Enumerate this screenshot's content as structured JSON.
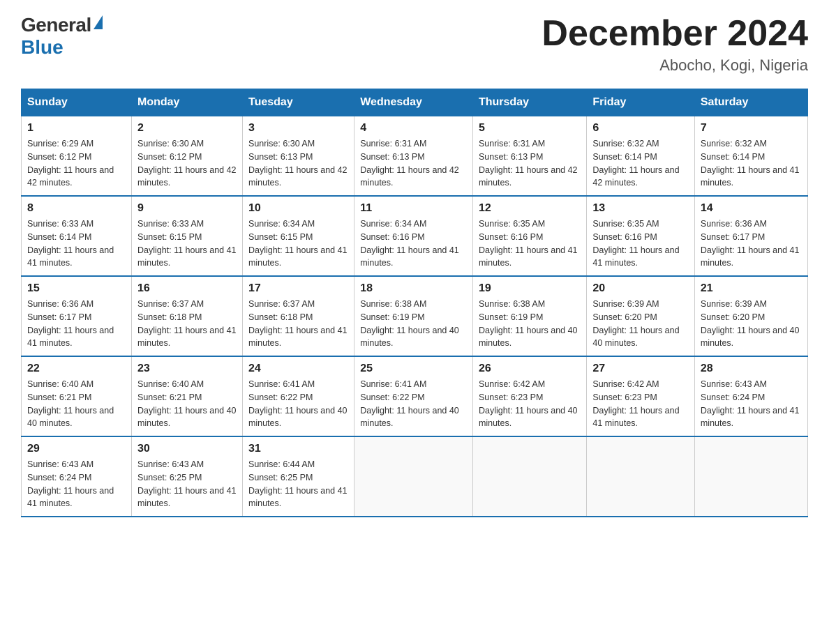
{
  "logo": {
    "general": "General",
    "blue": "Blue"
  },
  "title": "December 2024",
  "location": "Abocho, Kogi, Nigeria",
  "days_of_week": [
    "Sunday",
    "Monday",
    "Tuesday",
    "Wednesday",
    "Thursday",
    "Friday",
    "Saturday"
  ],
  "weeks": [
    [
      {
        "day": "1",
        "sunrise": "6:29 AM",
        "sunset": "6:12 PM",
        "daylight": "11 hours and 42 minutes."
      },
      {
        "day": "2",
        "sunrise": "6:30 AM",
        "sunset": "6:12 PM",
        "daylight": "11 hours and 42 minutes."
      },
      {
        "day": "3",
        "sunrise": "6:30 AM",
        "sunset": "6:13 PM",
        "daylight": "11 hours and 42 minutes."
      },
      {
        "day": "4",
        "sunrise": "6:31 AM",
        "sunset": "6:13 PM",
        "daylight": "11 hours and 42 minutes."
      },
      {
        "day": "5",
        "sunrise": "6:31 AM",
        "sunset": "6:13 PM",
        "daylight": "11 hours and 42 minutes."
      },
      {
        "day": "6",
        "sunrise": "6:32 AM",
        "sunset": "6:14 PM",
        "daylight": "11 hours and 42 minutes."
      },
      {
        "day": "7",
        "sunrise": "6:32 AM",
        "sunset": "6:14 PM",
        "daylight": "11 hours and 41 minutes."
      }
    ],
    [
      {
        "day": "8",
        "sunrise": "6:33 AM",
        "sunset": "6:14 PM",
        "daylight": "11 hours and 41 minutes."
      },
      {
        "day": "9",
        "sunrise": "6:33 AM",
        "sunset": "6:15 PM",
        "daylight": "11 hours and 41 minutes."
      },
      {
        "day": "10",
        "sunrise": "6:34 AM",
        "sunset": "6:15 PM",
        "daylight": "11 hours and 41 minutes."
      },
      {
        "day": "11",
        "sunrise": "6:34 AM",
        "sunset": "6:16 PM",
        "daylight": "11 hours and 41 minutes."
      },
      {
        "day": "12",
        "sunrise": "6:35 AM",
        "sunset": "6:16 PM",
        "daylight": "11 hours and 41 minutes."
      },
      {
        "day": "13",
        "sunrise": "6:35 AM",
        "sunset": "6:16 PM",
        "daylight": "11 hours and 41 minutes."
      },
      {
        "day": "14",
        "sunrise": "6:36 AM",
        "sunset": "6:17 PM",
        "daylight": "11 hours and 41 minutes."
      }
    ],
    [
      {
        "day": "15",
        "sunrise": "6:36 AM",
        "sunset": "6:17 PM",
        "daylight": "11 hours and 41 minutes."
      },
      {
        "day": "16",
        "sunrise": "6:37 AM",
        "sunset": "6:18 PM",
        "daylight": "11 hours and 41 minutes."
      },
      {
        "day": "17",
        "sunrise": "6:37 AM",
        "sunset": "6:18 PM",
        "daylight": "11 hours and 41 minutes."
      },
      {
        "day": "18",
        "sunrise": "6:38 AM",
        "sunset": "6:19 PM",
        "daylight": "11 hours and 40 minutes."
      },
      {
        "day": "19",
        "sunrise": "6:38 AM",
        "sunset": "6:19 PM",
        "daylight": "11 hours and 40 minutes."
      },
      {
        "day": "20",
        "sunrise": "6:39 AM",
        "sunset": "6:20 PM",
        "daylight": "11 hours and 40 minutes."
      },
      {
        "day": "21",
        "sunrise": "6:39 AM",
        "sunset": "6:20 PM",
        "daylight": "11 hours and 40 minutes."
      }
    ],
    [
      {
        "day": "22",
        "sunrise": "6:40 AM",
        "sunset": "6:21 PM",
        "daylight": "11 hours and 40 minutes."
      },
      {
        "day": "23",
        "sunrise": "6:40 AM",
        "sunset": "6:21 PM",
        "daylight": "11 hours and 40 minutes."
      },
      {
        "day": "24",
        "sunrise": "6:41 AM",
        "sunset": "6:22 PM",
        "daylight": "11 hours and 40 minutes."
      },
      {
        "day": "25",
        "sunrise": "6:41 AM",
        "sunset": "6:22 PM",
        "daylight": "11 hours and 40 minutes."
      },
      {
        "day": "26",
        "sunrise": "6:42 AM",
        "sunset": "6:23 PM",
        "daylight": "11 hours and 40 minutes."
      },
      {
        "day": "27",
        "sunrise": "6:42 AM",
        "sunset": "6:23 PM",
        "daylight": "11 hours and 41 minutes."
      },
      {
        "day": "28",
        "sunrise": "6:43 AM",
        "sunset": "6:24 PM",
        "daylight": "11 hours and 41 minutes."
      }
    ],
    [
      {
        "day": "29",
        "sunrise": "6:43 AM",
        "sunset": "6:24 PM",
        "daylight": "11 hours and 41 minutes."
      },
      {
        "day": "30",
        "sunrise": "6:43 AM",
        "sunset": "6:25 PM",
        "daylight": "11 hours and 41 minutes."
      },
      {
        "day": "31",
        "sunrise": "6:44 AM",
        "sunset": "6:25 PM",
        "daylight": "11 hours and 41 minutes."
      },
      null,
      null,
      null,
      null
    ]
  ]
}
